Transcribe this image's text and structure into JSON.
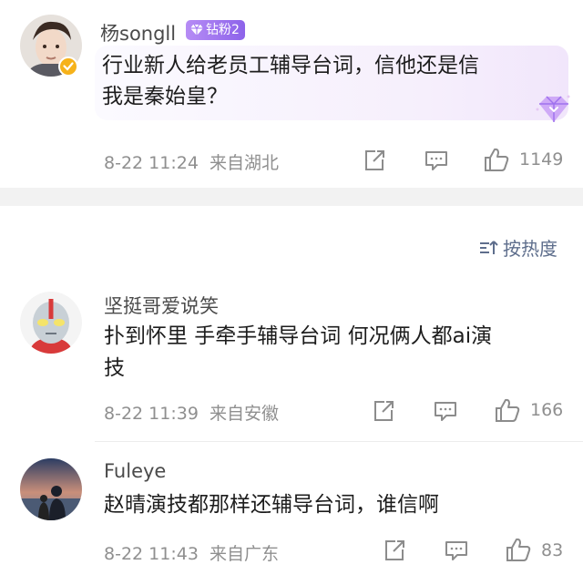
{
  "comments": [
    {
      "user": "杨songll",
      "badge": "钻粉2",
      "text_line1": "行业新人给老员工辅导台词，信他还是信",
      "text_line2": "我是秦始皇？",
      "time": "8-22 11:24",
      "location": "来自湖北",
      "likes": "1149"
    },
    {
      "user": "坚挺哥爱说笑",
      "text_line1": "扑到怀里 手牵手辅导台词 何况俩人都ai演",
      "text_line2": "技",
      "time": "8-22 11:39",
      "location": "来自安徽",
      "likes": "166"
    },
    {
      "user": "Fuleye",
      "text_line1": "赵晴演技都那样还辅导台词，谁信啊",
      "time": "8-22 11:43",
      "location": "来自广东",
      "likes": "83"
    }
  ],
  "sort": {
    "label": "按热度"
  },
  "colors": {
    "badge": "#9b6cf0",
    "meta": "#8f8f8f",
    "sort": "#5e6e8c"
  }
}
